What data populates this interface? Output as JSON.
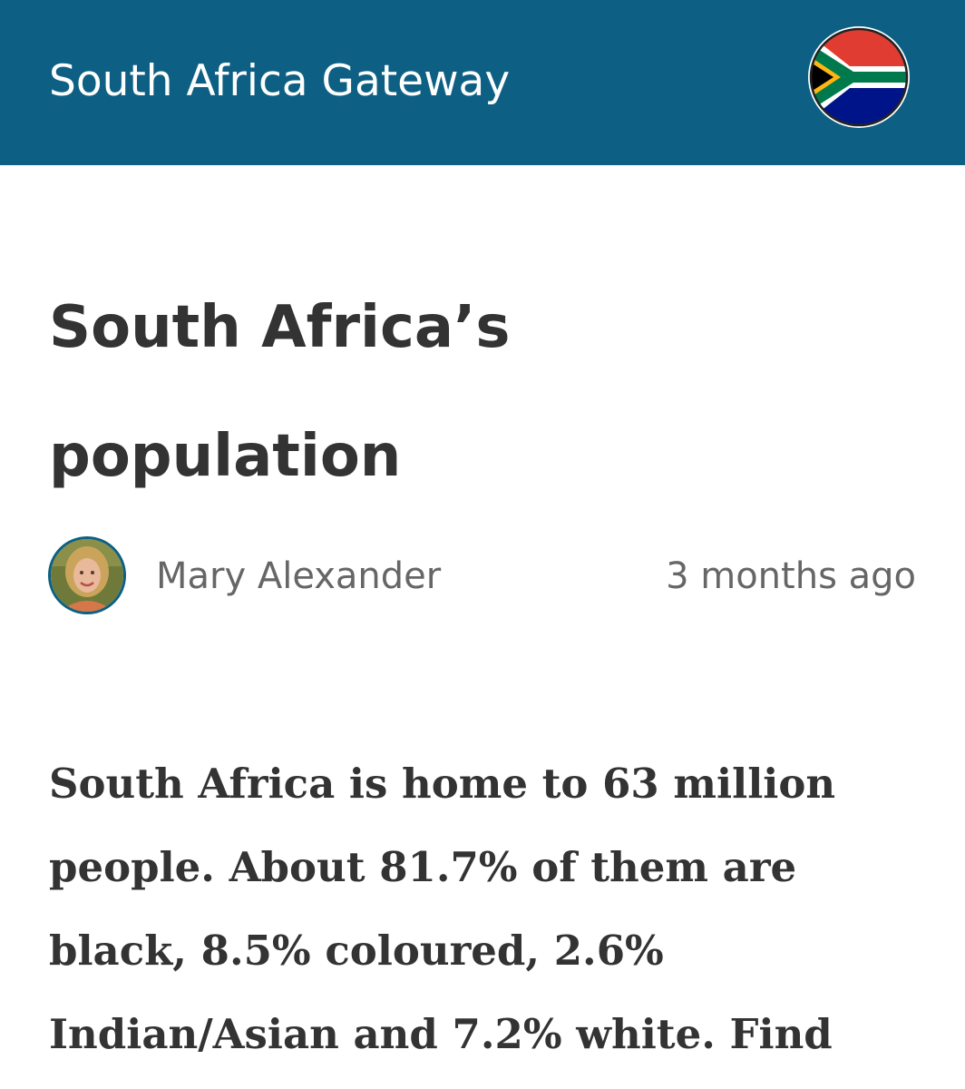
{
  "header": {
    "site_title": "South Africa Gateway",
    "flag_icon": "south-africa-flag-icon",
    "colors": {
      "background": "#0d6083",
      "flag_red": "#e03c31",
      "flag_green": "#007a4d",
      "flag_blue": "#001489",
      "flag_gold": "#ffb612",
      "flag_black": "#000000"
    }
  },
  "article": {
    "title_line1": "South Africa’s",
    "title_line2": "population",
    "author_name": "Mary Alexander",
    "author_avatar": "author-photo",
    "published": "3 months ago",
    "body_lines": [
      "South Africa is home to 63 million",
      "people. About 81.7% of them are",
      "black, 8.5% coloured, 2.6%",
      "Indian/Asian and 7.2% white. Find"
    ]
  }
}
